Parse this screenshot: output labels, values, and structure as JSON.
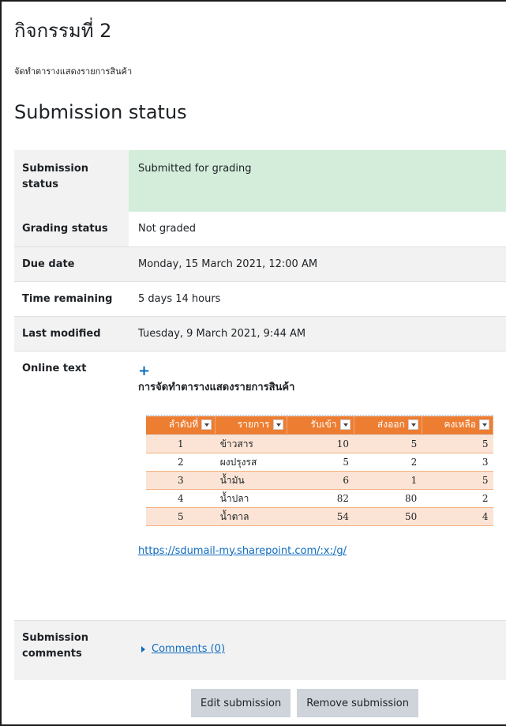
{
  "page": {
    "title": "กิจกรรมที่ 2",
    "intro": "จัดทำตารางแสดงรายการสินค้า"
  },
  "status": {
    "section_title": "Submission status",
    "rows": {
      "submission": {
        "label": "Submission status",
        "value": "Submitted for grading"
      },
      "grading": {
        "label": "Grading status",
        "value": "Not graded"
      },
      "due": {
        "label": "Due date",
        "value": "Monday, 15 March 2021, 12:00 AM"
      },
      "time": {
        "label": "Time remaining",
        "value": "5 days 14 hours"
      },
      "modified": {
        "label": "Last modified",
        "value": "Tuesday, 9 March 2021, 9:44 AM"
      },
      "online": {
        "label": "Online text"
      },
      "comments": {
        "label": "Submission comments",
        "link": "Comments (0)"
      }
    }
  },
  "online_text": {
    "plus_icon": "+",
    "title": "การจัดทำตารางแสดงรายการสินค้า",
    "link": "https://sdumail-my.sharepoint.com/:x:/g/",
    "table": {
      "headers": [
        "ลำดับที่",
        "รายการ",
        "รับเข้า",
        "ส่งออก",
        "คงเหลือ"
      ],
      "rows": [
        [
          "1",
          "ข้าวสาร",
          "10",
          "5",
          "5"
        ],
        [
          "2",
          "ผงปรุงรส",
          "5",
          "2",
          "3"
        ],
        [
          "3",
          "น้ำมัน",
          "6",
          "1",
          "5"
        ],
        [
          "4",
          "น้ำปลา",
          "82",
          "80",
          "2"
        ],
        [
          "5",
          "น้ำตาล",
          "54",
          "50",
          "4"
        ]
      ]
    }
  },
  "actions": {
    "edit": "Edit submission",
    "remove": "Remove submission"
  },
  "colors": {
    "link": "#0f6cbf",
    "submitted_bg": "#d4edda",
    "sheet_header": "#ed7d31",
    "sheet_band": "#fbe4d5"
  }
}
